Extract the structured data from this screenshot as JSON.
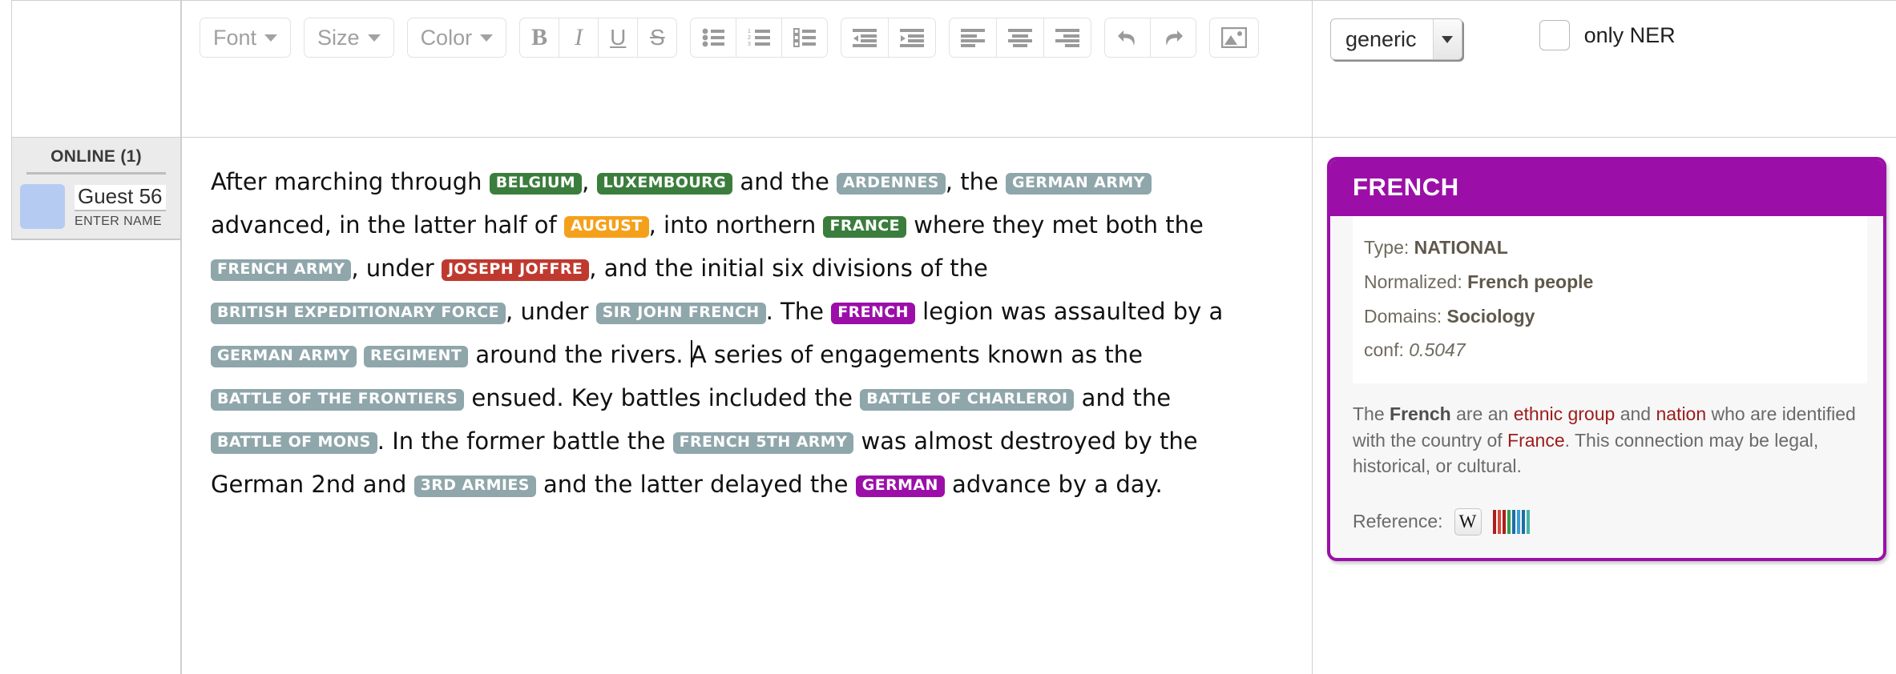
{
  "sidebar": {
    "online_title": "ONLINE (1)",
    "user": {
      "name": "Guest 56",
      "hint": "ENTER NAME"
    }
  },
  "toolbar": {
    "dropdowns": [
      {
        "label": "Font",
        "name": "font-dropdown"
      },
      {
        "label": "Size",
        "name": "size-dropdown"
      },
      {
        "label": "Color",
        "name": "color-dropdown"
      }
    ],
    "bold": "B",
    "italic": "I",
    "underline": "U",
    "strikethrough": "S",
    "icons": [
      "bullet-list-icon",
      "numbered-list-icon",
      "checklist-icon",
      "outdent-icon",
      "indent-icon",
      "align-left-icon",
      "align-center-icon",
      "align-right-icon",
      "undo-icon",
      "redo-icon",
      "image-icon"
    ]
  },
  "controls": {
    "mode_select": "generic",
    "only_ner_label": "only NER",
    "only_ner_checked": false
  },
  "document": {
    "tokens": [
      {
        "t": "After marching through "
      },
      {
        "e": "BELGIUM",
        "c": "loc"
      },
      {
        "t": ", "
      },
      {
        "e": "LUXEMBOURG",
        "c": "loc"
      },
      {
        "t": " and the "
      },
      {
        "e": "ARDENNES",
        "c": "org"
      },
      {
        "t": ", the "
      },
      {
        "e": "GERMAN ARMY",
        "c": "org"
      },
      {
        "t": " advanced, in the latter half of "
      },
      {
        "e": "AUGUST",
        "c": "date"
      },
      {
        "t": ", into northern "
      },
      {
        "e": "FRANCE",
        "c": "loc"
      },
      {
        "t": " where they met both the "
      },
      {
        "e": "FRENCH ARMY",
        "c": "org"
      },
      {
        "t": ", under "
      },
      {
        "e": "JOSEPH JOFFRE",
        "c": "per"
      },
      {
        "t": ", and the initial six divisions of the "
      },
      {
        "e": "BRITISH EXPEDITIONARY FORCE",
        "c": "org"
      },
      {
        "t": ", under "
      },
      {
        "e": "SIR JOHN FRENCH",
        "c": "org"
      },
      {
        "t": ". The "
      },
      {
        "e": "FRENCH",
        "c": "natl"
      },
      {
        "t": " legion was assaulted by a "
      },
      {
        "e": "GERMAN ARMY",
        "c": "org"
      },
      {
        "t": " "
      },
      {
        "e": "REGIMENT",
        "c": "org"
      },
      {
        "t": " around the rivers. "
      },
      {
        "caret": true
      },
      {
        "t": "A series of engagements known as the "
      },
      {
        "e": "BATTLE OF THE FRONTIERS",
        "c": "org"
      },
      {
        "t": " ensued. Key battles included the "
      },
      {
        "e": "BATTLE OF CHARLEROI",
        "c": "org"
      },
      {
        "t": " and the "
      },
      {
        "e": "BATTLE OF MONS",
        "c": "org"
      },
      {
        "t": ". In the former battle the "
      },
      {
        "e": "FRENCH 5TH ARMY",
        "c": "org"
      },
      {
        "t": " was almost destroyed by the German 2nd and "
      },
      {
        "e": "3RD ARMIES",
        "c": "org"
      },
      {
        "t": " and the latter delayed the "
      },
      {
        "e": "GERMAN",
        "c": "natl"
      },
      {
        "t": " advance by a day."
      }
    ]
  },
  "card": {
    "title": "FRENCH",
    "accent": "#9b0fa8",
    "facts": [
      {
        "label": "Type:",
        "value": "NATIONAL",
        "italic": false
      },
      {
        "label": "Normalized:",
        "value": "French people",
        "italic": false
      },
      {
        "label": "Domains:",
        "value": "Sociology",
        "italic": false
      },
      {
        "label": "conf:",
        "value": "0.5047",
        "italic": true
      }
    ],
    "description": {
      "p1": "The ",
      "bold1": "French",
      "p2": " are an ",
      "link1": "ethnic group",
      "p3": " and ",
      "link2": "nation",
      "p4": " who are identified with the country of ",
      "link3": "France",
      "p5": ". This connection may be legal, historical, or cultural."
    },
    "reference_label": "Reference:",
    "wikipedia_glyph": "W"
  },
  "entity_colors": {
    "location": "#3b7d3c",
    "date": "#f5a01b",
    "person": "#c0392f",
    "organization": "#8fa6ab",
    "national": "#9b0fa8"
  }
}
